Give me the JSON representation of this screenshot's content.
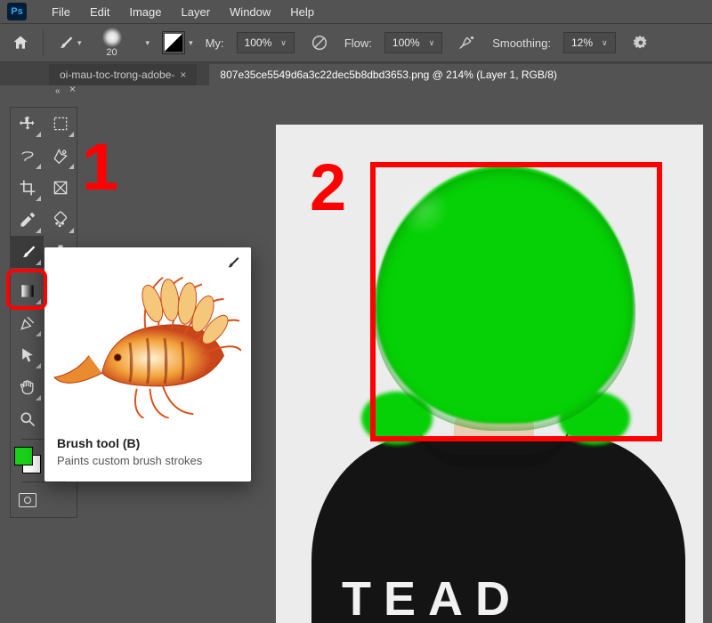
{
  "app": {
    "short": "Ps"
  },
  "menu": {
    "file": "File",
    "edit": "Edit",
    "image": "Image",
    "layer": "Layer",
    "window": "Window",
    "help": "Help"
  },
  "options": {
    "brush_size": "20",
    "opacity_label": "My:",
    "opacity_value": "100%",
    "flow_label": "Flow:",
    "flow_value": "100%",
    "smoothing_label": "Smoothing:",
    "smoothing_value": "12%"
  },
  "tabs": {
    "inactive_fragment": "oi-mau-toc-trong-adobe-",
    "active": "807e35ce5549d6a3c22dec5b8dbd3653.png @ 214% (Layer 1, RGB/8)",
    "close_glyph": "×"
  },
  "tooltip": {
    "title": "Brush tool (B)",
    "desc": "Paints custom brush strokes"
  },
  "colors": {
    "foreground": "#1ad11a",
    "accent_green": "#06d106",
    "annotation": "#ff0000"
  },
  "annotations": {
    "one": "1",
    "two": "2"
  },
  "canvas": {
    "shirt_text": "TEAD"
  }
}
